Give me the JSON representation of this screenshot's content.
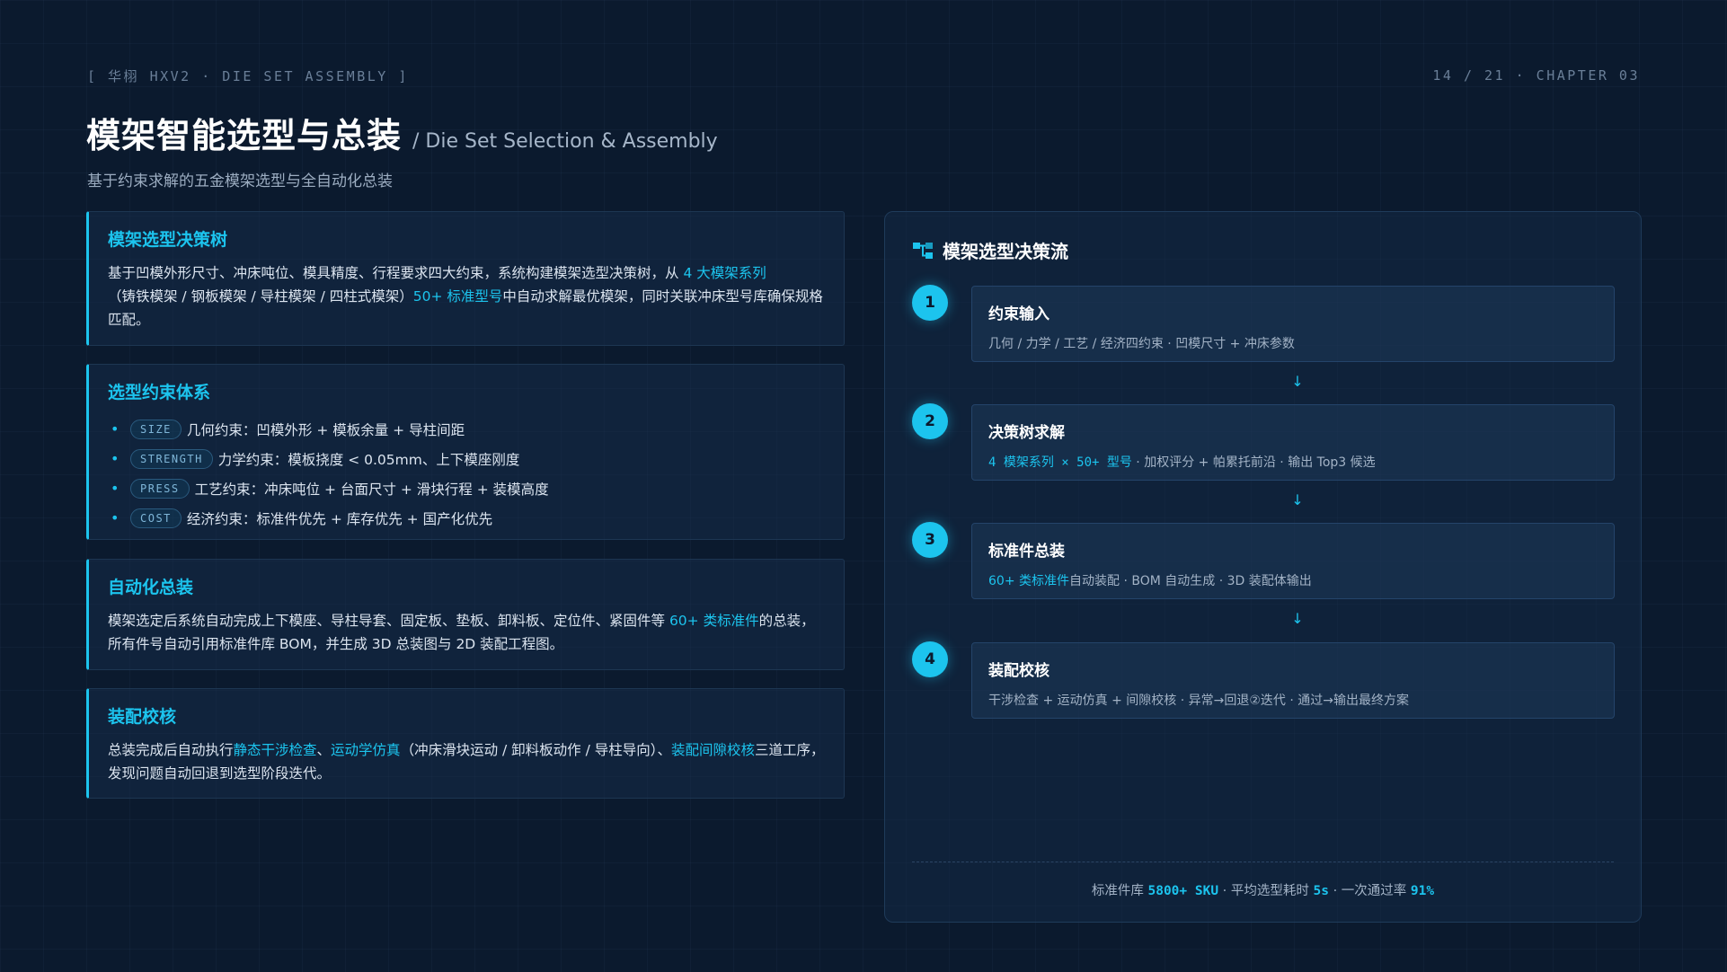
{
  "header": {
    "tag": "[ 华栩 HXV2 · DIE SET ASSEMBLY ]",
    "page": "14 / 21 · CHAPTER 03"
  },
  "title": {
    "main": "模架智能选型与总装",
    "english": "/ Die Set Selection & Assembly",
    "subtitle": "基于约束求解的五金模架选型与全自动化总装"
  },
  "cards": {
    "decision_tree": {
      "title": "模架选型决策树",
      "text1": "基于凹模外形尺寸、冲床吨位、模具精度、行程要求四大约束，系统构建模架选型决策树，从 ",
      "highlight1": "4 大模架系列",
      "text2": "（铸铁模架 / 钢板模架 / 导柱模架 / 四柱式模架）",
      "highlight2": "50+ 标准型号",
      "text3": "中自动求解最优模架，同时关联冲床型号库确保规格匹配。"
    },
    "constraints": {
      "title": "选型约束体系",
      "items": [
        {
          "tag": "SIZE",
          "text": "几何约束：凹模外形 + 模板余量 + 导柱间距"
        },
        {
          "tag": "STRENGTH",
          "text": "力学约束：模板挠度 < 0.05mm、上下模座刚度"
        },
        {
          "tag": "PRESS",
          "text": "工艺约束：冲床吨位 + 台面尺寸 + 滑块行程 + 装模高度"
        },
        {
          "tag": "COST",
          "text": "经济约束：标准件优先 + 库存优先 + 国产化优先"
        }
      ]
    },
    "auto_assembly": {
      "title": "自动化总装",
      "text1": "模架选定后系统自动完成上下模座、导柱导套、固定板、垫板、卸料板、定位件、紧固件等 ",
      "highlight1": "60+ 类标准件",
      "text2": "的总装，所有件号自动引用标准件库 BOM，并生成 3D 总装图与 2D 装配工程图。"
    },
    "verification": {
      "title": "装配校核",
      "text1": "总装完成后自动执行",
      "highlight1": "静态干涉检查",
      "text2": "、",
      "highlight2": "运动学仿真",
      "text3": "（冲床滑块运动 / 卸料板动作 / 导柱导向）、",
      "highlight3": "装配间隙校核",
      "text4": "三道工序，发现问题自动回退到选型阶段迭代。"
    }
  },
  "flow": {
    "title": "模架选型决策流",
    "steps": [
      {
        "num": "1",
        "title": "约束输入",
        "detail_hi": "",
        "detail": "几何 / 力学 / 工艺 / 经济四约束 · 凹模尺寸 + 冲床参数"
      },
      {
        "num": "2",
        "title": "决策树求解",
        "detail_hi": "4 模架系列 × 50+ 型号",
        "detail": " · 加权评分 + 帕累托前沿 · 输出 Top3 候选"
      },
      {
        "num": "3",
        "title": "标准件总装",
        "detail_hi": "60+ 类标准件",
        "detail": "自动装配 · BOM 自动生成 · 3D 装配体输出"
      },
      {
        "num": "4",
        "title": "装配校核",
        "detail_hi": "",
        "detail": "干涉检查 + 运动仿真 + 间隙校核 · 异常→回退②迭代 · 通过→输出最终方案"
      }
    ],
    "arrow": "↓",
    "stats": {
      "label1": "标准件库 ",
      "value1": "5800+ SKU",
      "label2": " · 平均选型耗时 ",
      "value2": "5s",
      "label3": " · 一次通过率 ",
      "value3": "91%"
    }
  },
  "colors": {
    "background": "#0b1a2e",
    "accent": "#1cc4ee",
    "card": "#162c48"
  }
}
